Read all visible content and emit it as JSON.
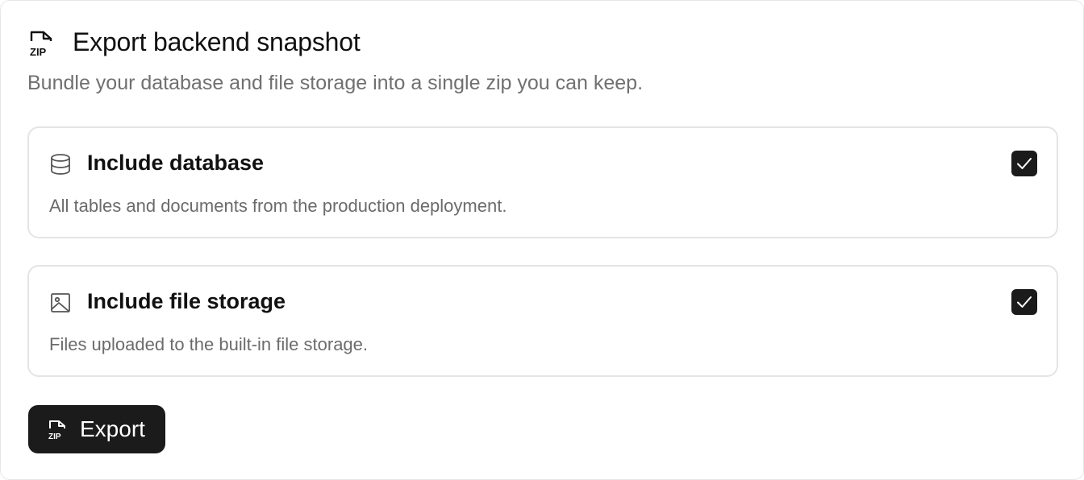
{
  "header": {
    "icon": "zip-file-icon",
    "title": "Export backend snapshot",
    "subtitle": "Bundle your database and file storage into a single zip you can keep."
  },
  "options": [
    {
      "icon": "database-icon",
      "title": "Include database",
      "description": "All tables and documents from the production deployment.",
      "checked": true
    },
    {
      "icon": "image-icon",
      "title": "Include file storage",
      "description": "Files uploaded to the built-in file storage.",
      "checked": true
    }
  ],
  "export_button": {
    "icon": "zip-file-icon",
    "label": "Export"
  },
  "colors": {
    "primary_dark": "#1b1b1b",
    "muted_text": "#707070",
    "border": "#e4e4e4"
  }
}
